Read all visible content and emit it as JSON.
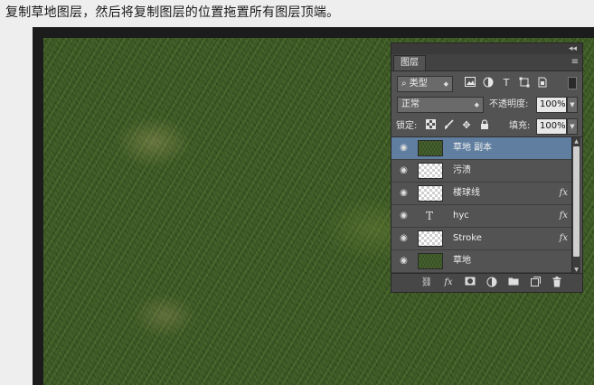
{
  "caption": "复制草地图层，然后将复制图层的位置拖置所有图层顶端。",
  "panel": {
    "tab_label": "图层",
    "collapse_glyph": "◂◂",
    "menu_glyph": "≡",
    "filter": {
      "kind_label": "类型",
      "search_glyph": "⌕"
    },
    "blend": {
      "mode": "正常",
      "opacity_label": "不透明度:",
      "opacity_value": "100%"
    },
    "lock": {
      "label": "锁定:",
      "fill_label": "填充:",
      "fill_value": "100%"
    },
    "layers": [
      {
        "name": "草地 副本",
        "thumb": "grass",
        "fx": "",
        "selected": true
      },
      {
        "name": "污渍",
        "thumb": "transparent",
        "fx": ""
      },
      {
        "name": "楼球线",
        "thumb": "transparent",
        "fx": "fx"
      },
      {
        "name": "hyc",
        "thumb": "type",
        "type_glyph": "T",
        "fx": "fx"
      },
      {
        "name": "Stroke",
        "thumb": "transparent",
        "fx": "fx"
      },
      {
        "name": "草地",
        "thumb": "grass",
        "fx": ""
      }
    ]
  }
}
